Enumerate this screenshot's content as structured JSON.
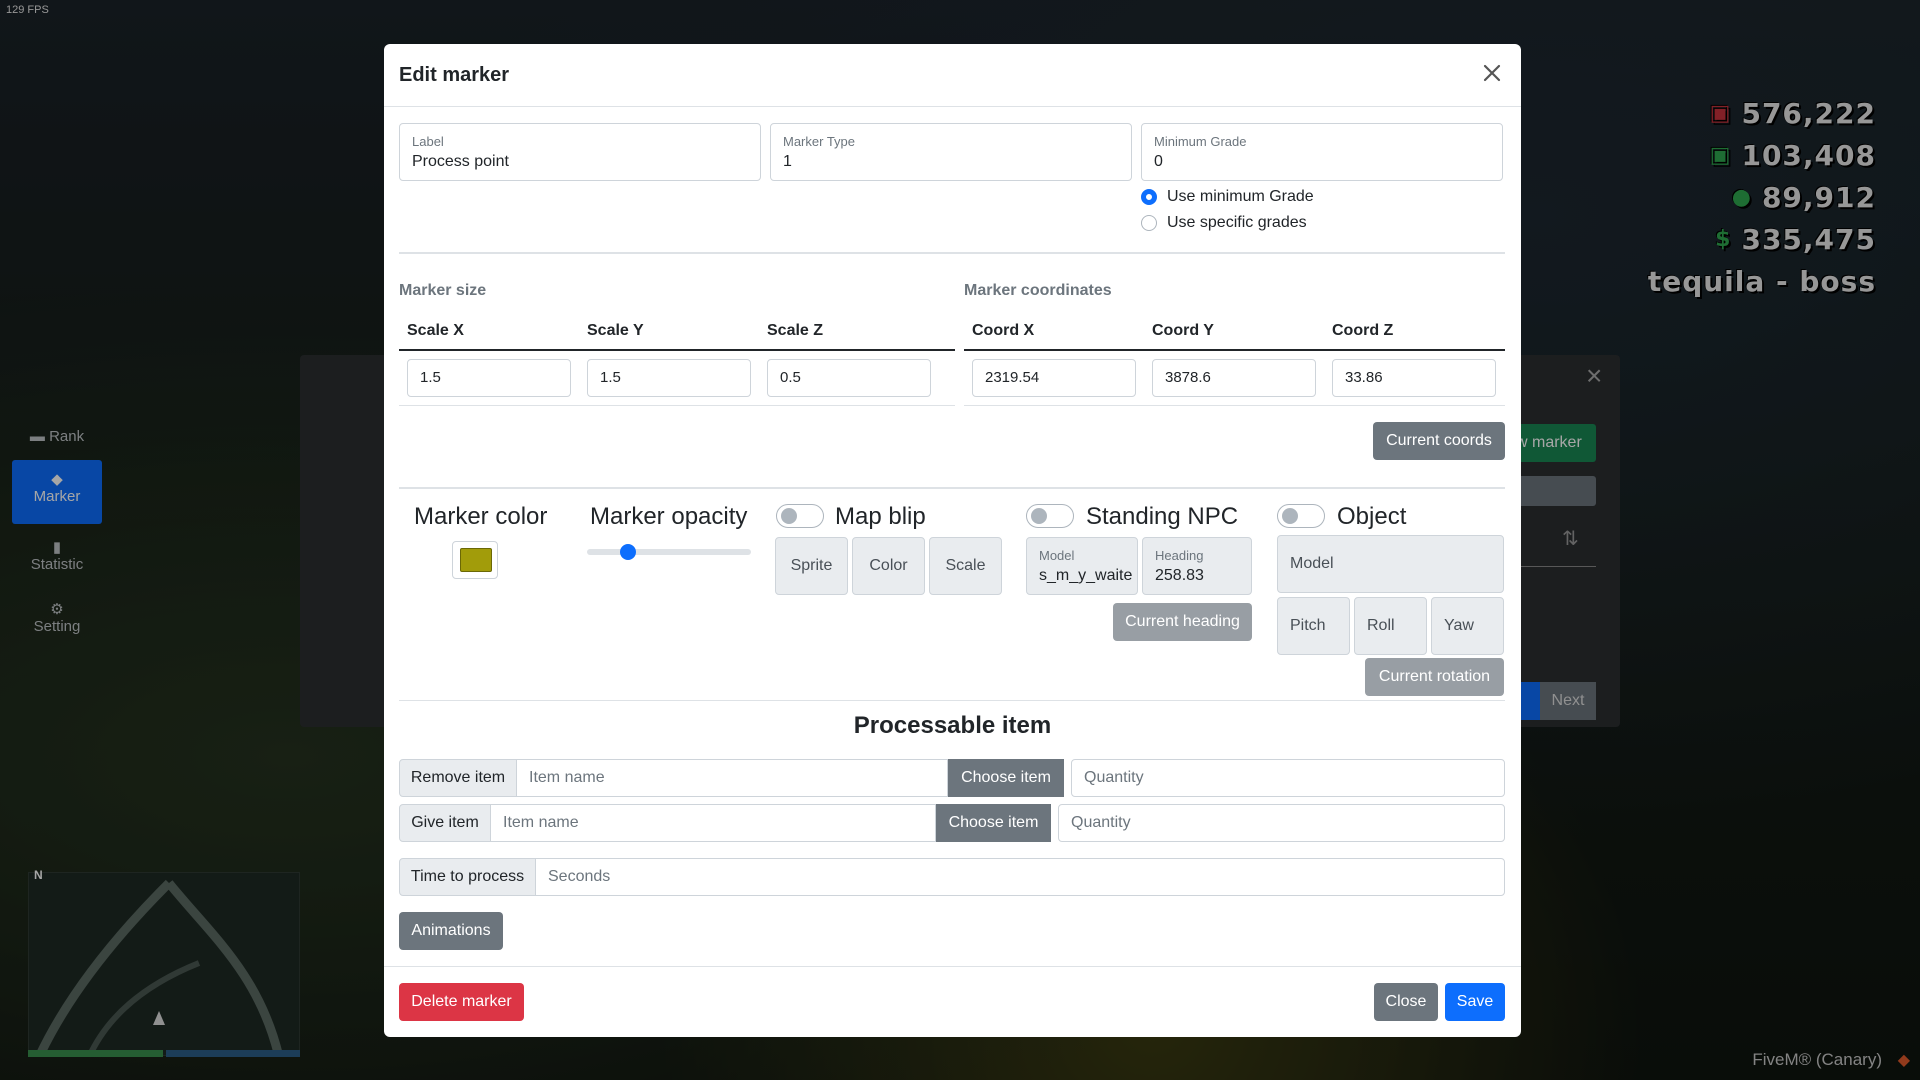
{
  "hud": {
    "fps": "129 FPS",
    "cash": "576,222",
    "bank": "103,408",
    "black_money": "89,912",
    "extra": "335,475",
    "job": "tequila - boss",
    "fivem": "FiveM® (Canary)"
  },
  "background_menu": {
    "side_items": [
      "Rank",
      "Marker",
      "Statistic",
      "Setting"
    ],
    "new_marker_button": "w marker",
    "next_button": "Next"
  },
  "modal": {
    "title": "Edit marker",
    "fields": {
      "label": {
        "label": "Label",
        "value": "Process point"
      },
      "marker_type": {
        "label": "Marker Type",
        "value": "1"
      },
      "minimum_grade": {
        "label": "Minimum Grade",
        "value": "0"
      }
    },
    "grade_options": [
      {
        "label": "Use minimum Grade",
        "checked": true
      },
      {
        "label": "Use specific grades",
        "checked": false
      }
    ],
    "marker_size": {
      "title": "Marker size",
      "headers": [
        "Scale X",
        "Scale Y",
        "Scale Z"
      ],
      "values": [
        "1.5",
        "1.5",
        "0.5"
      ]
    },
    "marker_coordinates": {
      "title": "Marker coordinates",
      "headers": [
        "Coord X",
        "Coord Y",
        "Coord Z"
      ],
      "values": [
        "2319.54",
        "3878.6",
        "33.86"
      ],
      "button": "Current coords"
    },
    "marker_color": {
      "label": "Marker color",
      "value": "#a29c0a"
    },
    "marker_opacity": {
      "label": "Marker opacity",
      "value_fraction": 0.22
    },
    "map_blip": {
      "label": "Map blip",
      "enabled": false,
      "buttons": [
        "Sprite",
        "Color",
        "Scale"
      ]
    },
    "standing_npc": {
      "label": "Standing NPC",
      "enabled": false,
      "model": {
        "label": "Model",
        "value": "s_m_y_waite"
      },
      "heading": {
        "label": "Heading",
        "value": "258.83"
      },
      "button": "Current heading"
    },
    "object": {
      "label": "Object",
      "enabled": false,
      "model": "Model",
      "rotation": [
        "Pitch",
        "Roll",
        "Yaw"
      ],
      "button": "Current rotation"
    },
    "processable_item": {
      "title": "Processable item",
      "remove_row": {
        "label": "Remove item",
        "item_placeholder": "Item name",
        "button": "Choose item",
        "qty_placeholder": "Quantity"
      },
      "give_row": {
        "label": "Give item",
        "item_placeholder": "Item name",
        "button": "Choose item",
        "qty_placeholder": "Quantity"
      },
      "time_row": {
        "label": "Time to process",
        "placeholder": "Seconds"
      },
      "animations_button": "Animations"
    },
    "footer": {
      "delete": "Delete marker",
      "close": "Close",
      "save": "Save"
    }
  }
}
